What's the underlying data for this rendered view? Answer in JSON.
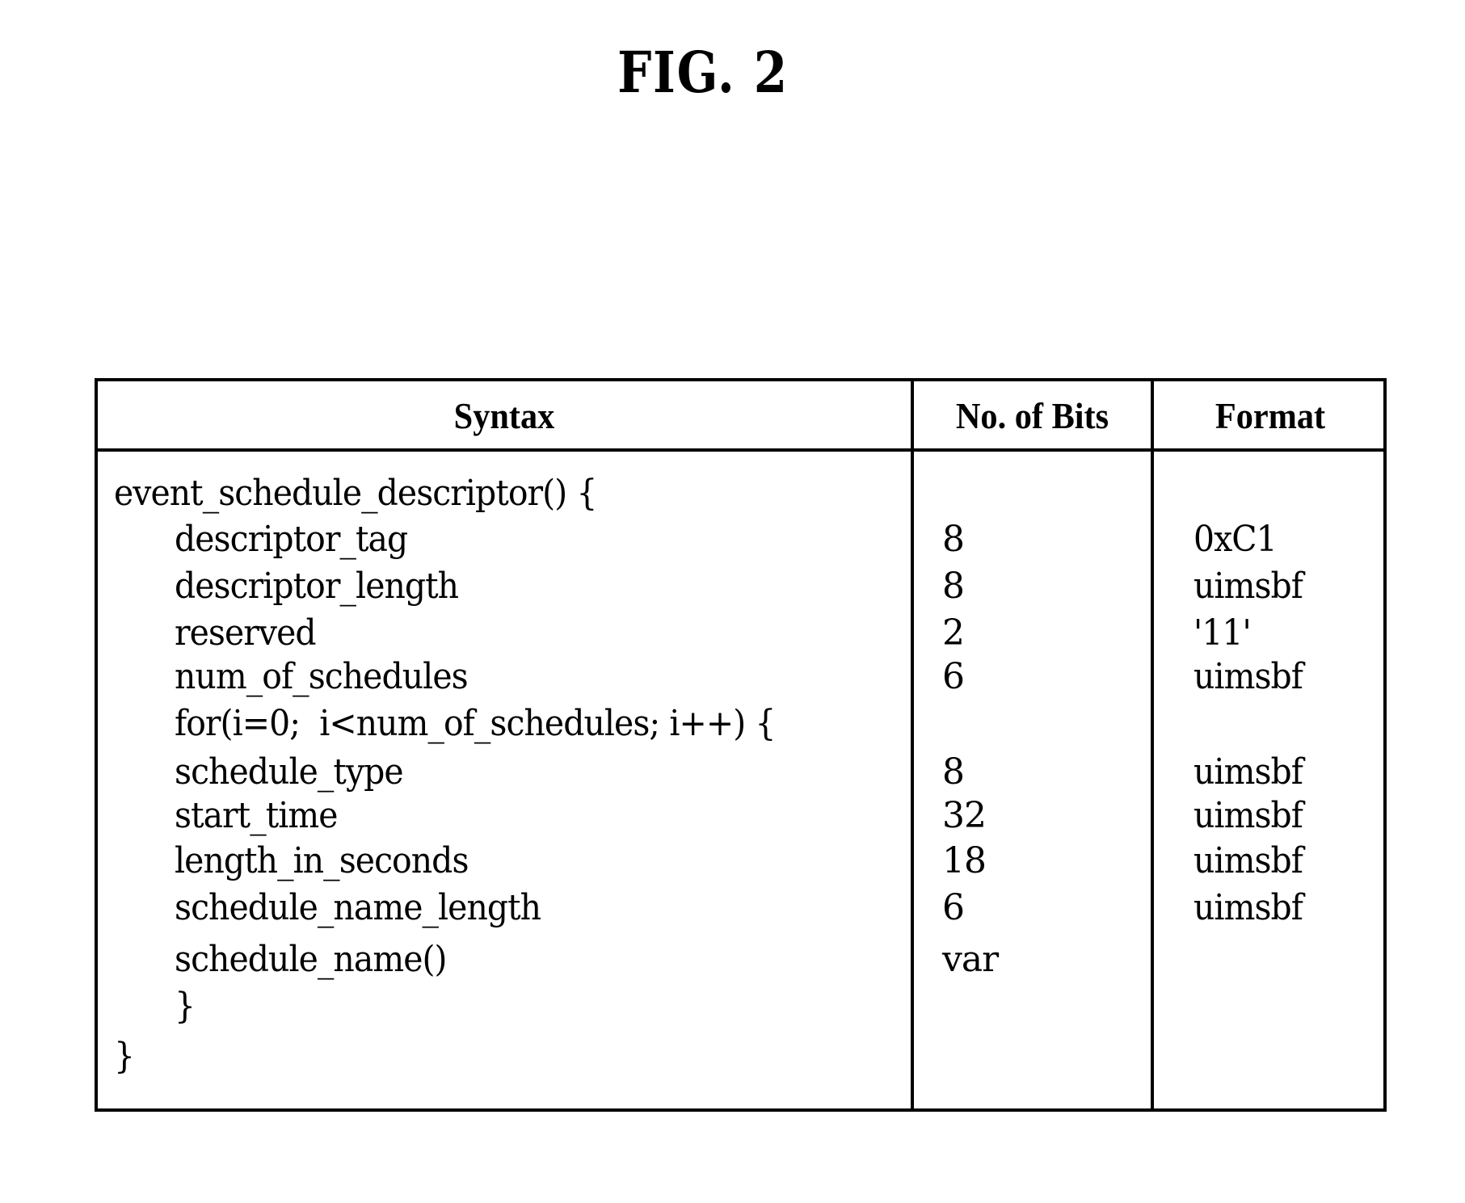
{
  "figure": {
    "title": "FIG. 2"
  },
  "table": {
    "headers": [
      "Syntax",
      "No. of Bits",
      "Format"
    ],
    "rows": [
      {
        "syntax": "event_schedule_descriptor() {",
        "indent": 0,
        "bits": "",
        "format": ""
      },
      {
        "syntax": "descriptor_tag",
        "indent": 1,
        "bits": "8",
        "format": "0xC1"
      },
      {
        "syntax": "descriptor_length",
        "indent": 1,
        "bits": "8",
        "format": "uimsbf"
      },
      {
        "syntax": "reserved",
        "indent": 1,
        "bits": "2",
        "format": "'11'"
      },
      {
        "syntax": "num_of_schedules",
        "indent": 1,
        "bits": "6",
        "format": "uimsbf"
      },
      {
        "syntax": "for(i=0;  i<num_of_schedules; i++) {",
        "indent": 1,
        "bits": "",
        "format": ""
      },
      {
        "syntax": "schedule_type",
        "indent": 1,
        "bits": "8",
        "format": "uimsbf"
      },
      {
        "syntax": "start_time",
        "indent": 1,
        "bits": "32",
        "format": "uimsbf"
      },
      {
        "syntax": "length_in_seconds",
        "indent": 1,
        "bits": "18",
        "format": "uimsbf"
      },
      {
        "syntax": "schedule_name_length",
        "indent": 1,
        "bits": "6",
        "format": "uimsbf"
      },
      {
        "syntax": "schedule_name()",
        "indent": 1,
        "bits": "var",
        "format": ""
      },
      {
        "syntax": "}",
        "indent": 1,
        "bits": "",
        "format": ""
      },
      {
        "syntax": "}",
        "indent": 0,
        "bits": "",
        "format": ""
      }
    ]
  }
}
